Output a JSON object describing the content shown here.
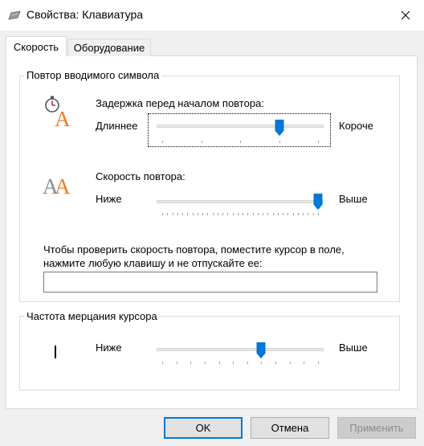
{
  "window": {
    "title": "Свойства: Клавиатура"
  },
  "tabs": [
    {
      "label": "Скорость",
      "active": true
    },
    {
      "label": "Оборудование",
      "active": false
    }
  ],
  "repeat_group": {
    "title": "Повтор вводимого символа",
    "delay": {
      "label": "Задержка перед началом повтора:",
      "min_label": "Длиннее",
      "max_label": "Короче",
      "value": 3,
      "min": 0,
      "max": 4
    },
    "rate": {
      "label": "Скорость повтора:",
      "min_label": "Ниже",
      "max_label": "Выше",
      "value": 31,
      "min": 0,
      "max": 31
    },
    "test_hint_line1": "Чтобы проверить скорость повтора, поместите курсор в поле,",
    "test_hint_line2": "нажмите любую клавишу и не отпускайте ее:",
    "test_value": ""
  },
  "blink_group": {
    "title": "Частота мерцания курсора",
    "min_label": "Ниже",
    "max_label": "Выше",
    "value": 7,
    "min": 0,
    "max": 11
  },
  "buttons": {
    "ok": "OK",
    "cancel": "Отмена",
    "apply": "Применить"
  },
  "colors": {
    "accent": "#0078d7",
    "icon_orange": "#f07b24"
  }
}
